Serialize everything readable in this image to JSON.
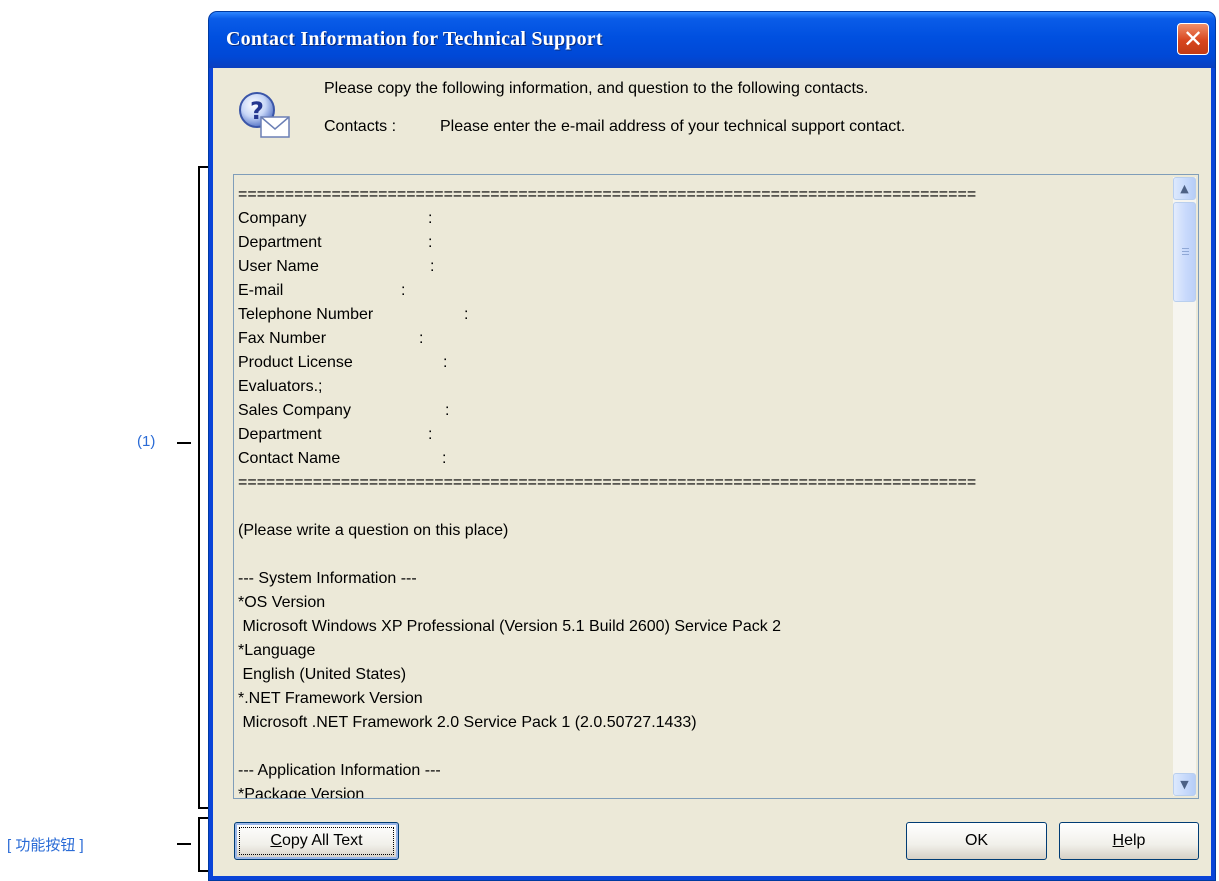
{
  "window": {
    "title": "Contact Information for Technical Support",
    "close_glyph": "✕"
  },
  "header": {
    "icon": "question-mail-icon",
    "instruction": "Please copy the following information, and question to the following contacts.",
    "contacts_label": "Contacts :",
    "contacts_text": "Please enter the e-mail address of your technical support contact."
  },
  "annotations": {
    "area_label": "(1)",
    "buttons_label": "[ 功能按钮 ]"
  },
  "textarea": {
    "separator": "===============================================================================",
    "fields": [
      {
        "label": "Company",
        "colon": ":"
      },
      {
        "label": "Department",
        "colon": ":"
      },
      {
        "label": "User Name",
        "colon": ":"
      },
      {
        "label": "E-mail",
        "colon": ":"
      },
      {
        "label": "Telephone Number",
        "colon": ":"
      },
      {
        "label": "Fax Number",
        "colon": ":"
      },
      {
        "label": "Product License",
        "colon": ":"
      },
      {
        "label": "Evaluators.;",
        "colon": ""
      },
      {
        "label": "Sales Company",
        "colon": ":"
      },
      {
        "label": "Department",
        "colon": ":"
      },
      {
        "label": "Contact Name",
        "colon": ":"
      }
    ],
    "separator2": "===============================================================================",
    "question_placeholder": "(Please write a question on this place)",
    "system_info_header": "--- System Information ---",
    "os_label": "*OS Version",
    "os_value": " Microsoft Windows XP Professional (Version 5.1 Build 2600) Service Pack 2",
    "language_label": "*Language",
    "language_value": " English (United States)",
    "net_label": "*.NET Framework Version",
    "net_value": " Microsoft .NET Framework 2.0 Service Pack 1 (2.0.50727.1433)",
    "app_info_header": "--- Application Information ---",
    "package_label": "*Package Version"
  },
  "scrollbar": {
    "up_glyph": "▲",
    "down_glyph": "▼"
  },
  "buttons": {
    "copy_all_text_prefix": "C",
    "copy_all_text_rest": "opy All Text",
    "ok": "OK",
    "help_prefix": "H",
    "help_rest": "elp"
  },
  "colors": {
    "title_bar": "#0050e0",
    "client_background": "#ece9d8",
    "annotation_text": "#2a6bd6",
    "close_button": "#d8461e"
  }
}
